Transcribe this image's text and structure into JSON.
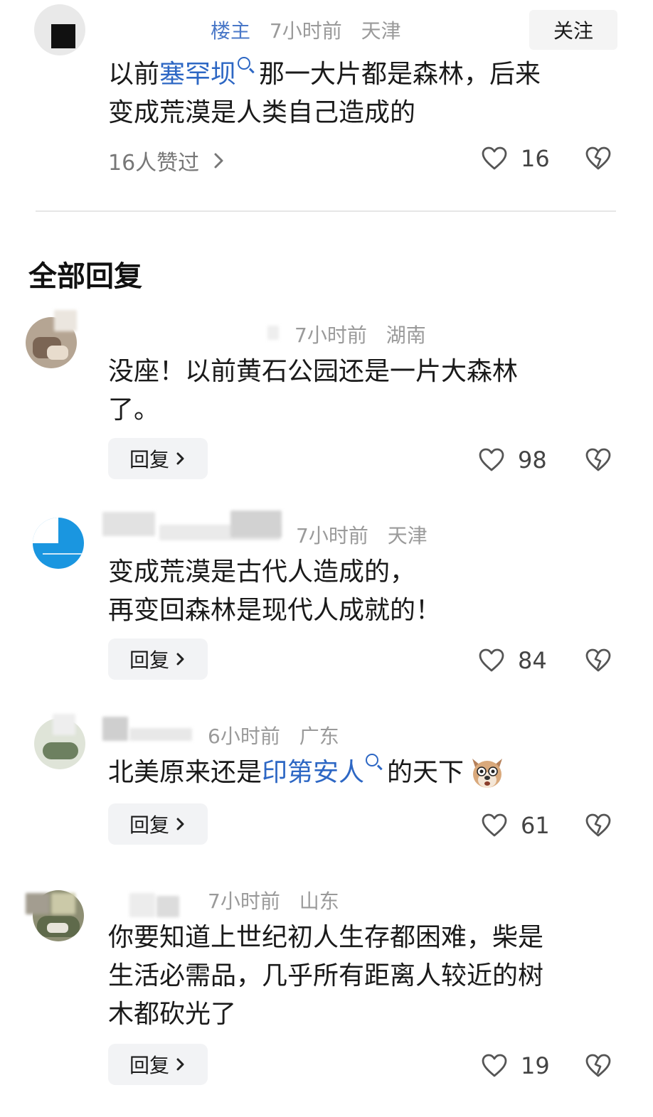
{
  "op_comment": {
    "badge": "楼主",
    "time": "7小时前",
    "location": "天津",
    "follow_label": "关注",
    "text_before": "以前",
    "link_text": "塞罕坝",
    "text_after_line1": "那一大片都是森林，后来",
    "text_line2": "变成荒漠是人类自己造成的",
    "liked_by": "16人赞过",
    "like_count": "16"
  },
  "section_title": "全部回复",
  "reply_label": "回复",
  "replies": [
    {
      "time": "7小时前",
      "location": "湖南",
      "line1": "没座！以前黄石公园还是一片大森林",
      "line2": "了。",
      "like_count": "98"
    },
    {
      "time": "7小时前",
      "location": "天津",
      "line1": "变成荒漠是古代人造成的，",
      "line2": "再变回森林是现代人成就的！",
      "like_count": "84"
    },
    {
      "time": "6小时前",
      "location": "广东",
      "text_before": "北美原来还是",
      "link_text": "印第安人",
      "text_after": "的天下",
      "emoji": "dog-face-emoji",
      "like_count": "61"
    },
    {
      "time": "7小时前",
      "location": "山东",
      "line1": "你要知道上世纪初人生存都困难，柴是",
      "line2": "生活必需品，几乎所有距离人较近的树",
      "line3": "木都砍光了",
      "like_count": "19"
    }
  ],
  "icons": {
    "like": "heart-outline-icon",
    "dislike": "broken-heart-icon",
    "chevron": "chevron-right-icon",
    "search": "search-icon"
  },
  "colors": {
    "link": "#2d67c4",
    "meta": "#9a9a9a",
    "badge": "#4a78c8",
    "button_bg": "#f2f3f5"
  }
}
